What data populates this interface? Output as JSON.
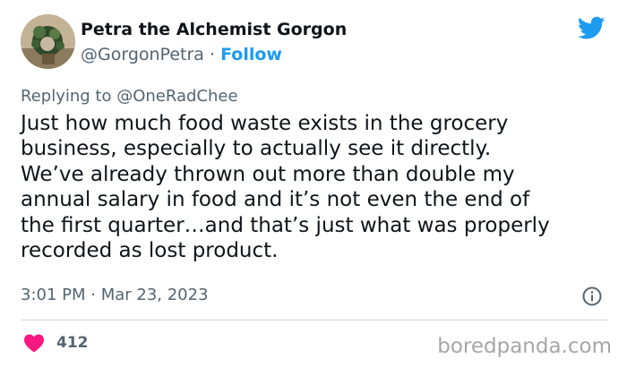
{
  "author": {
    "display_name": "Petra the Alchemist Gorgon",
    "handle": "@GorgonPetra",
    "separator": " · ",
    "follow_label": "Follow",
    "avatar_icon": "avatar-photo"
  },
  "reply": {
    "label": "Replying to ",
    "target": "@OneRadChee"
  },
  "tweet": {
    "lines": [
      "Just how much food waste exists in the grocery",
      "business, especially to actually see it directly.",
      "We’ve already thrown out more than double my",
      "annual salary in food and it’s not even the end of",
      "the first quarter…and that’s just what was properly",
      "recorded as lost product."
    ]
  },
  "meta": {
    "time": "3:01 PM",
    "dot": " · ",
    "date": "Mar 23, 2023"
  },
  "stats": {
    "likes": "412"
  },
  "watermark": "boredpanda.com",
  "colors": {
    "twitter_blue": "#1d9bf0",
    "heart_red": "#f91880",
    "secondary_text": "#536471",
    "divider": "#cfd9de"
  }
}
